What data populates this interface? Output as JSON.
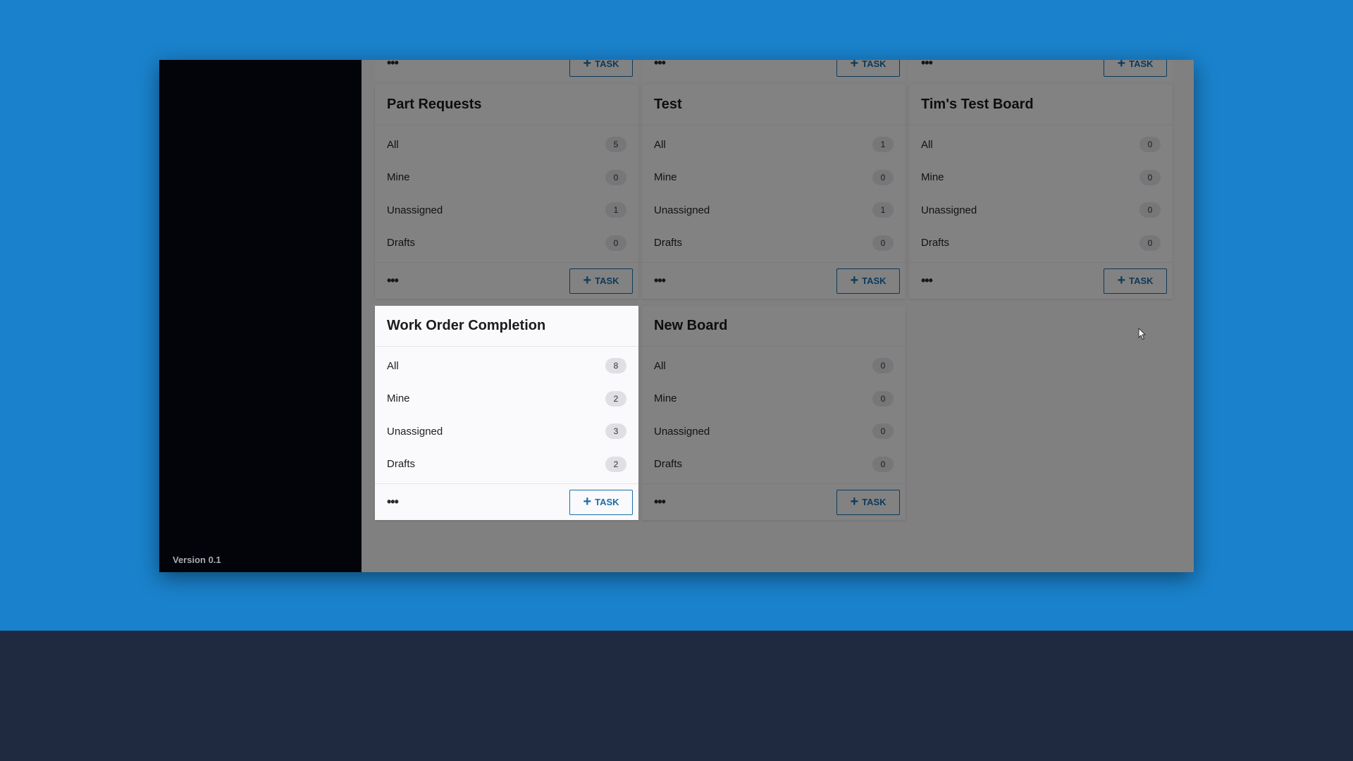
{
  "sidebar": {
    "version": "Version 0.1"
  },
  "task_button_label": "TASK",
  "boards": [
    {
      "title": "Part Requests",
      "rows": [
        {
          "label": "All",
          "count": "5"
        },
        {
          "label": "Mine",
          "count": "0"
        },
        {
          "label": "Unassigned",
          "count": "1"
        },
        {
          "label": "Drafts",
          "count": "0"
        }
      ]
    },
    {
      "title": "Test",
      "rows": [
        {
          "label": "All",
          "count": "1"
        },
        {
          "label": "Mine",
          "count": "0"
        },
        {
          "label": "Unassigned",
          "count": "1"
        },
        {
          "label": "Drafts",
          "count": "0"
        }
      ]
    },
    {
      "title": "Tim's Test Board",
      "rows": [
        {
          "label": "All",
          "count": "0"
        },
        {
          "label": "Mine",
          "count": "0"
        },
        {
          "label": "Unassigned",
          "count": "0"
        },
        {
          "label": "Drafts",
          "count": "0"
        }
      ]
    },
    {
      "title": "Work Order Completion",
      "rows": [
        {
          "label": "All",
          "count": "8"
        },
        {
          "label": "Mine",
          "count": "2"
        },
        {
          "label": "Unassigned",
          "count": "3"
        },
        {
          "label": "Drafts",
          "count": "2"
        }
      ]
    },
    {
      "title": "New Board",
      "rows": [
        {
          "label": "All",
          "count": "0"
        },
        {
          "label": "Mine",
          "count": "0"
        },
        {
          "label": "Unassigned",
          "count": "0"
        },
        {
          "label": "Drafts",
          "count": "0"
        }
      ]
    }
  ],
  "colors": {
    "desktop_background": "#1a82cc",
    "sidebar": "#02040a",
    "accent": "#1a6ea8"
  }
}
